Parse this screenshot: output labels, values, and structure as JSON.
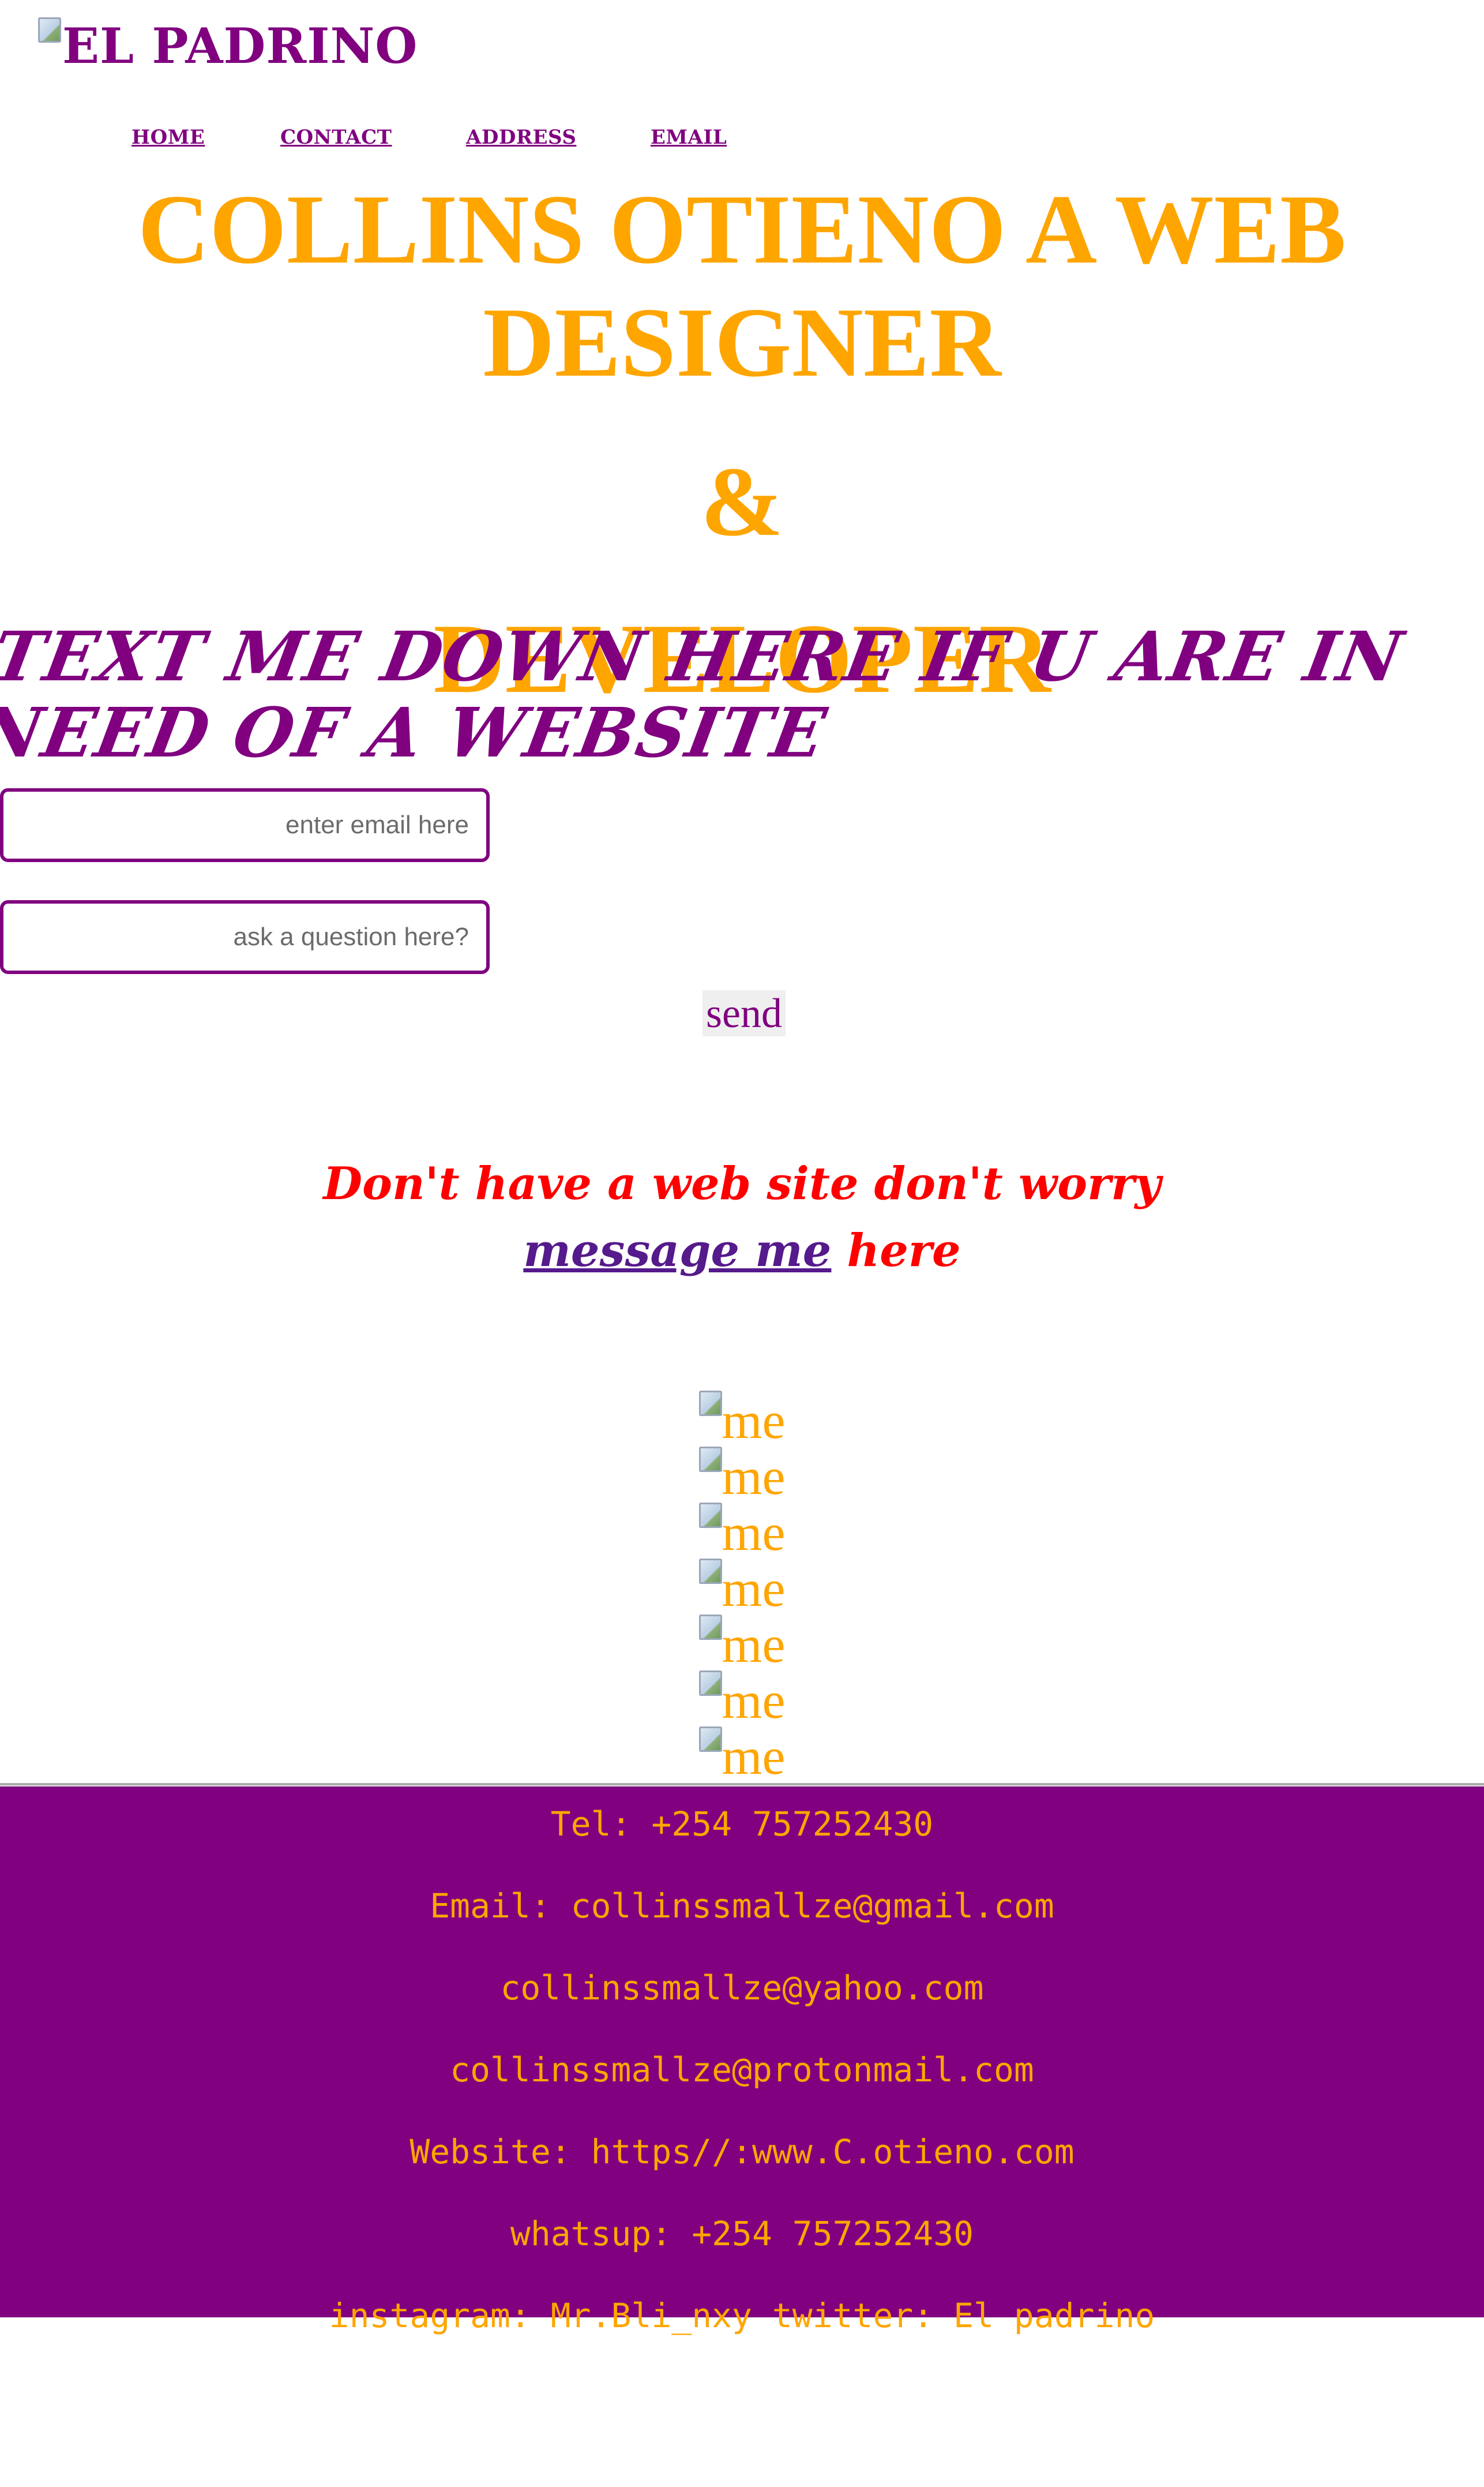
{
  "header": {
    "logo_text": "EL PADRINO",
    "nav": [
      "HOME",
      "CONTACT",
      "ADDRESS",
      "EMAIL"
    ]
  },
  "hero": {
    "line1": "COLLINS OTIENO A WEB",
    "line2": "DESIGNER",
    "line3": "&",
    "line4": "DEVELOPER"
  },
  "cta": {
    "line1": "TEXT ME DOWN HERE IF U ARE IN",
    "line2": "NEED OF A WEBSITE"
  },
  "form": {
    "email_placeholder": "enter email here",
    "question_placeholder": "ask a question here?",
    "send_label": "send"
  },
  "promo": {
    "line1": "Don't have a web site don't worry",
    "link_text": "message me",
    "after_link": " here"
  },
  "gallery": {
    "alt": "me",
    "count": 7
  },
  "footer": {
    "lines": [
      "Tel: +254 757252430",
      "Email: collinssmallze@gmail.com",
      "collinssmallze@yahoo.com",
      "collinssmallze@protonmail.com",
      "Website: https//:www.C.otieno.com",
      "whatsup: +254 757252430",
      "instagram: Mr.Bli_nxy twitter: El padrino"
    ]
  },
  "colors": {
    "purple": "#800080",
    "orange": "#FFA500",
    "red": "#FF0000",
    "link": "#551A8B"
  }
}
